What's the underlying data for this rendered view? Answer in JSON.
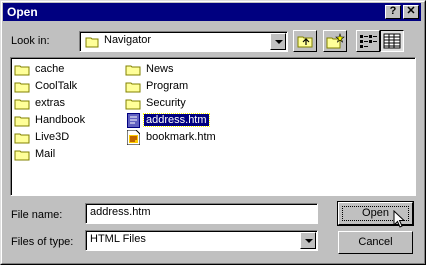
{
  "window": {
    "title": "Open"
  },
  "titlebar": {
    "help_glyph": "?",
    "close_glyph": "✕"
  },
  "look_in": {
    "label": "Look in:",
    "value": "Navigator"
  },
  "files": [
    {
      "name": "cache",
      "type": "folder"
    },
    {
      "name": "CoolTalk",
      "type": "folder"
    },
    {
      "name": "extras",
      "type": "folder"
    },
    {
      "name": "Handbook",
      "type": "folder"
    },
    {
      "name": "Live3D",
      "type": "folder"
    },
    {
      "name": "Mail",
      "type": "folder"
    },
    {
      "name": "News",
      "type": "folder"
    },
    {
      "name": "Program",
      "type": "folder"
    },
    {
      "name": "Security",
      "type": "folder"
    },
    {
      "name": "address.htm",
      "type": "file",
      "selected": true
    },
    {
      "name": "bookmark.htm",
      "type": "file"
    }
  ],
  "file_name": {
    "label": "File name:",
    "value": "address.htm"
  },
  "file_type": {
    "label": "Files of type:",
    "value": "HTML Files"
  },
  "buttons": {
    "open": "Open",
    "cancel": "Cancel"
  },
  "icons": {
    "toolbar": [
      "up-one-level-icon",
      "create-new-folder-icon",
      "list-view-icon",
      "details-view-icon"
    ],
    "folder_color": "#ffff99",
    "selection_color": "#000080",
    "title_color": "#000080"
  }
}
